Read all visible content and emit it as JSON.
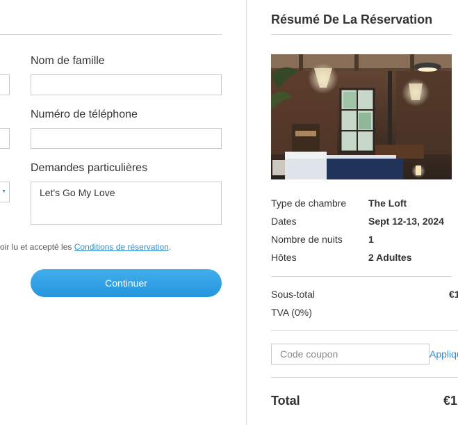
{
  "form": {
    "last_name_label": "Nom de famille",
    "last_name_value": "",
    "phone_label": "Numéro de téléphone",
    "phone_value": "",
    "requests_label": "Demandes particulières",
    "requests_value": "Let's Go My Love",
    "terms_text": "oir lu et accepté les ",
    "terms_link": "Conditions de réservation",
    "terms_end": ".",
    "continue_label": "Continuer"
  },
  "summary": {
    "title": "Résumé De La Réservation",
    "details": [
      {
        "label": "Type de chambre",
        "value": "The Loft"
      },
      {
        "label": "Dates",
        "value": "Sept 12-13, 2024"
      },
      {
        "label": "Nombre de nuits",
        "value": "1"
      },
      {
        "label": "Hôtes",
        "value": "2 Adultes"
      }
    ],
    "subtotal_label": "Sous-total",
    "subtotal_value": "€1",
    "tax_label": "TVA (0%)",
    "coupon_placeholder": "Code coupon",
    "apply_label": "Appliqu",
    "total_label": "Total",
    "total_value": "€1"
  },
  "colors": {
    "accent": "#2f8fcf",
    "button": "#2a9be0",
    "divider": "#d6d6d6"
  }
}
